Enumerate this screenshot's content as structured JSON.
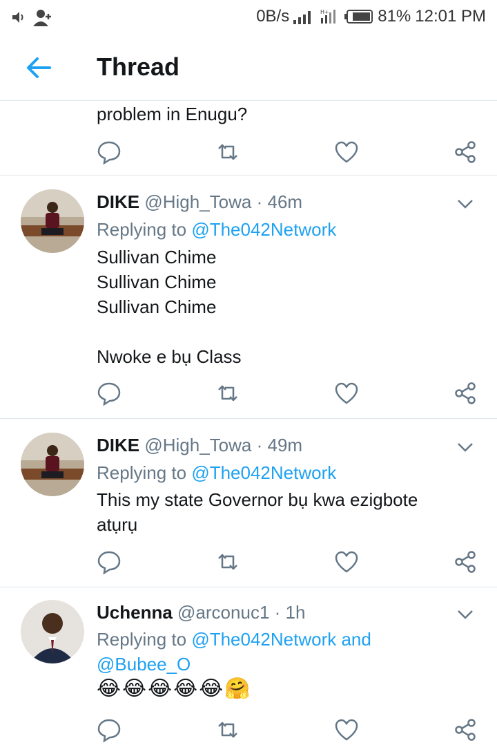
{
  "status_bar": {
    "speed": "0B/s",
    "battery": "81%",
    "time": "12:01 PM"
  },
  "header": {
    "title": "Thread"
  },
  "partial_tweet": {
    "text": "problem in Enugu?"
  },
  "tweets": [
    {
      "name": "DIKE",
      "handle": "@High_Towa",
      "time": "· 46m",
      "replying_label": "Replying to",
      "replying_to": "@The042Network",
      "lines": [
        "Sullivan Chime",
        "Sullivan Chime",
        "Sullivan Chime",
        "",
        "Nwoke e bụ Class"
      ]
    },
    {
      "name": "DIKE",
      "handle": "@High_Towa",
      "time": "· 49m",
      "replying_label": "Replying to",
      "replying_to": "@The042Network",
      "lines": [
        "This my state Governor bụ kwa ezigbote",
        "atụrụ"
      ]
    },
    {
      "name": "Uchenna",
      "handle": "@arconuc1",
      "time": "· 1h",
      "replying_label": "Replying to",
      "replying_to": "@The042Network and",
      "replying_to_2": "@Bubee_O",
      "emojis": "😂😂😂😂😂🤗"
    }
  ],
  "colors": {
    "accent": "#1da1f2",
    "muted": "#657786",
    "divider": "#e1e8ed"
  }
}
